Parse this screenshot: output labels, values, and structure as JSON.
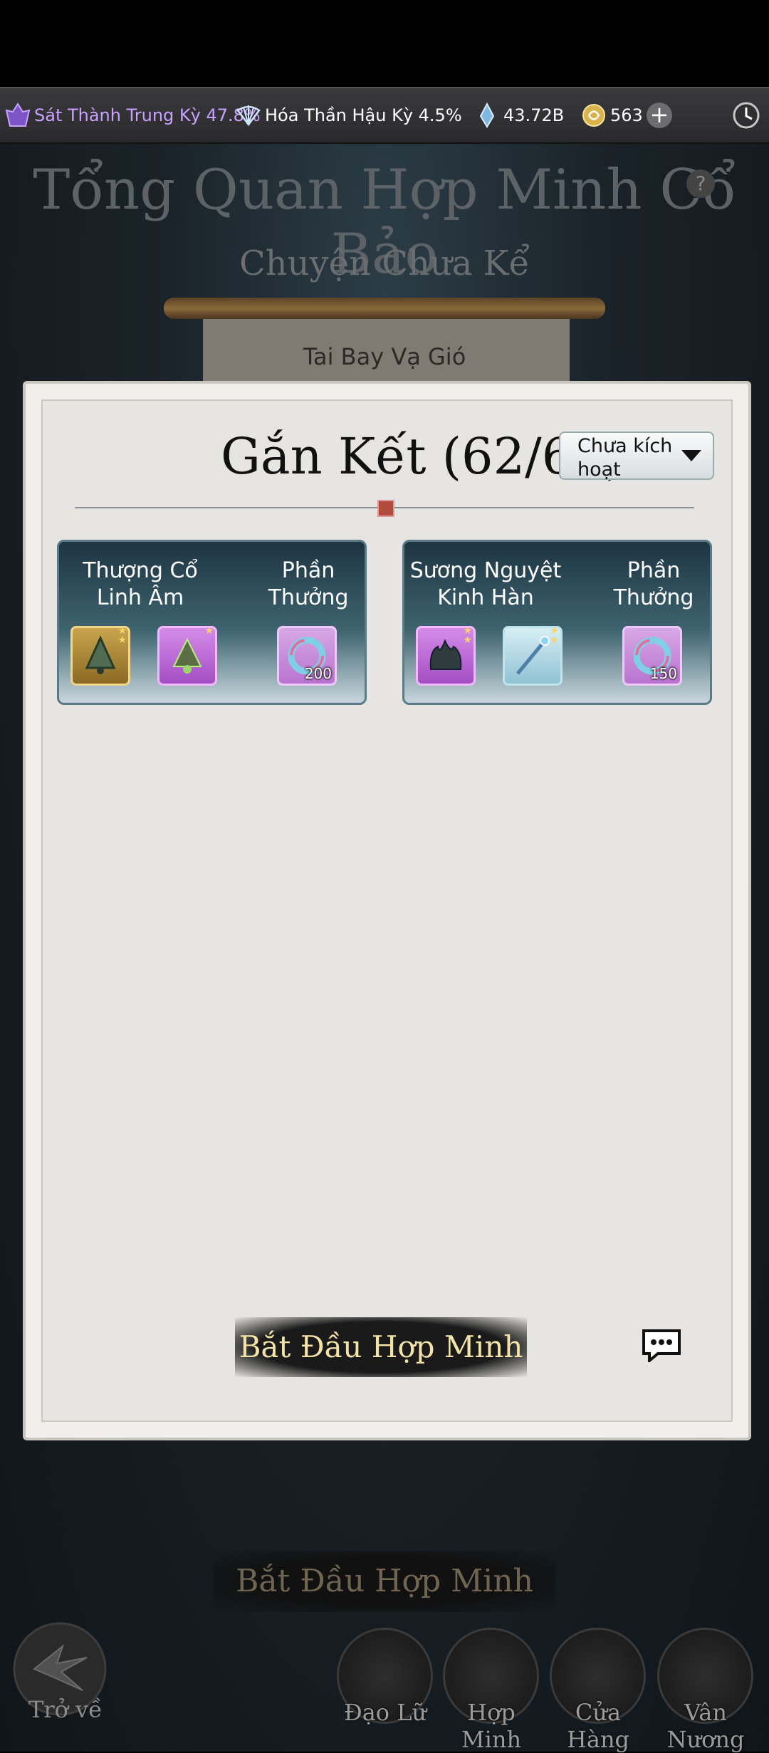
{
  "status": {
    "cultivation": "Sát Thành Trung Kỳ 47.8%",
    "transformation": "Hóa Thần Hậu Kỳ 4.5%",
    "crystals": "43.72B",
    "coins": "563",
    "plus_label": "+"
  },
  "background": {
    "title": "Tổng Quan Hợp Minh Cổ Bảo",
    "subtitle": "Chuyện Chưa Kể",
    "scroll_text": "Tai Bay Vạ Gió",
    "start_button": "Bắt Đầu Hợp Minh"
  },
  "panel": {
    "title": "Gắn Kết (62/64)",
    "dropdown_label": "Chưa kích hoạt",
    "cards": [
      {
        "name": "Thượng Cổ Linh Âm",
        "reward_label": "Phần Thưởng",
        "reward_count": "200"
      },
      {
        "name": "Sương Nguyệt Kinh Hàn",
        "reward_label": "Phần Thưởng",
        "reward_count": "150"
      }
    ],
    "start_button": "Bắt Đầu Hợp Minh"
  },
  "nav": {
    "back": "Trở về",
    "items": [
      "Đạo Lữ",
      "Hợp Minh",
      "Cửa Hàng",
      "Vân Nương"
    ]
  },
  "help_label": "?"
}
